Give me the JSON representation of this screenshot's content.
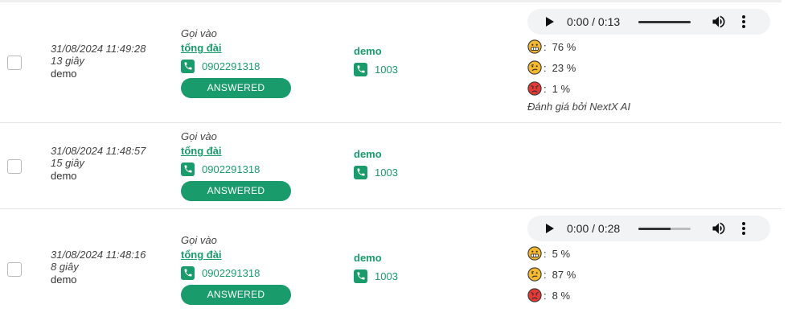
{
  "colors": {
    "accent": "#1a9b6b",
    "angry": "#e53935",
    "happy": "#f5b82e"
  },
  "calls": [
    {
      "datetime": "31/08/2024 11:49:28",
      "duration": "13 giây",
      "user": "demo",
      "call_prefix": "Gọi vào",
      "destination": "tổng đài",
      "phone": "0902291318",
      "status": "ANSWERED",
      "agent": "demo",
      "extension": "1003",
      "audio": {
        "time": "0:00 / 0:13",
        "progress": 1.0
      },
      "sentiment": [
        {
          "icon": "grinning-emoji-icon",
          "value": "76 %"
        },
        {
          "icon": "confused-emoji-icon",
          "value": "23 %"
        },
        {
          "icon": "angry-emoji-icon",
          "value": "1 %"
        }
      ],
      "rated_by": "Đánh giá bởi NextX AI"
    },
    {
      "datetime": "31/08/2024 11:48:57",
      "duration": "15 giây",
      "user": "demo",
      "call_prefix": "Gọi vào",
      "destination": "tổng đài",
      "phone": "0902291318",
      "status": "ANSWERED",
      "agent": "demo",
      "extension": "1003"
    },
    {
      "datetime": "31/08/2024 11:48:16",
      "duration": "8 giây",
      "user": "demo",
      "call_prefix": "Gọi vào",
      "destination": "tổng đài",
      "phone": "0902291318",
      "status": "ANSWERED",
      "agent": "demo",
      "extension": "1003",
      "audio": {
        "time": "0:00 / 0:28",
        "progress": 0.62
      },
      "sentiment": [
        {
          "icon": "grinning-emoji-icon",
          "value": "5 %"
        },
        {
          "icon": "confused-emoji-icon",
          "value": "87 %"
        },
        {
          "icon": "angry-emoji-icon",
          "value": "8 %"
        }
      ]
    }
  ]
}
